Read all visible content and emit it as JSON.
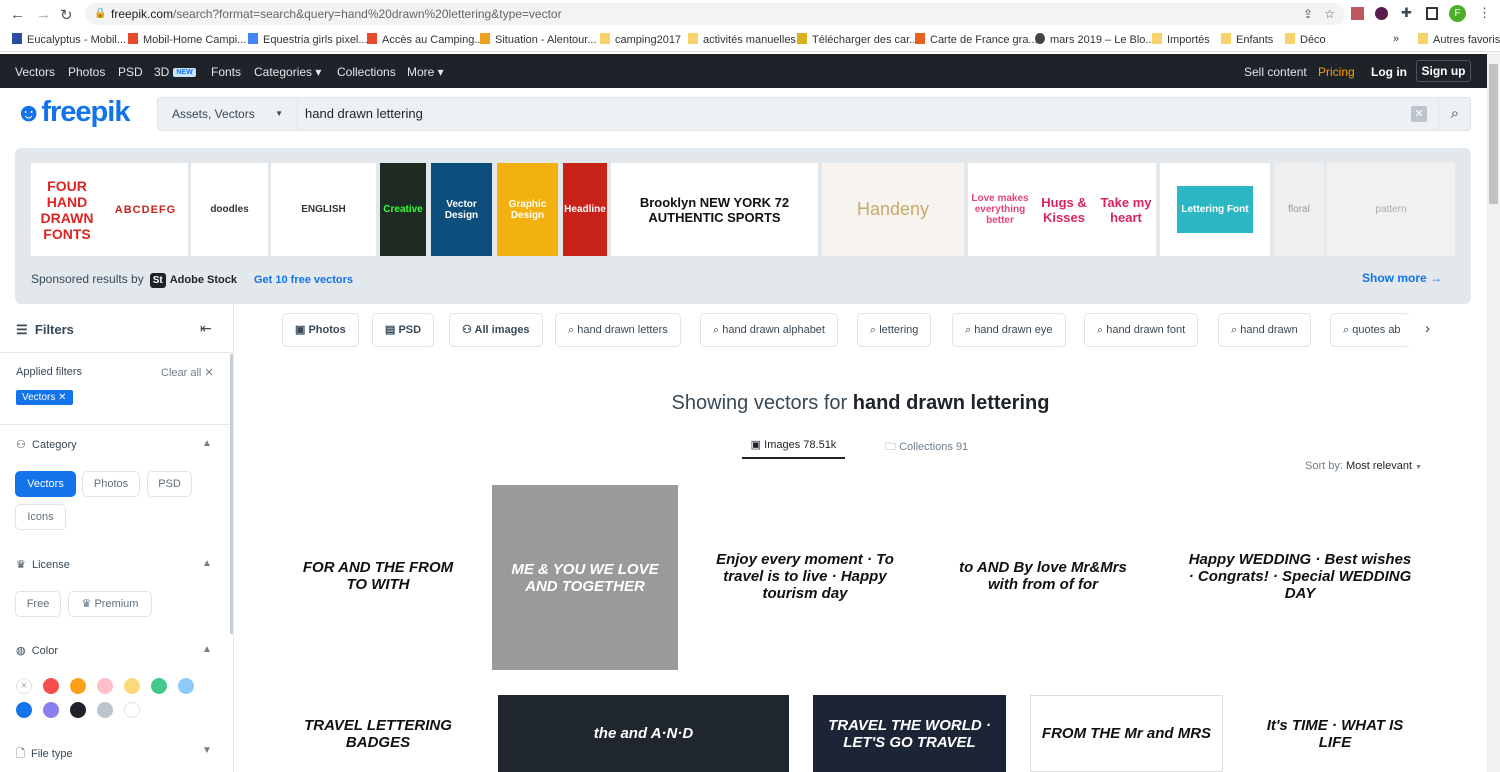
{
  "browser": {
    "url_domain": "freepik.com",
    "url_path": "/search?format=search&query=hand%20drawn%20lettering&type=vector",
    "profile_initial": "F",
    "bookmarks": [
      "Eucalyptus - Mobil...",
      "Mobil-Home Campi...",
      "Equestria girls pixel...",
      "Accès au Camping...",
      "Situation - Alentour...",
      "camping2017",
      "activités manuelles",
      "Télécharger des car...",
      "Carte de France gra...",
      "mars 2019 – Le Blo...",
      "Importés",
      "Enfants",
      "Déco"
    ],
    "more": "»",
    "other_bookmarks": "Autres favoris"
  },
  "topnav": {
    "items": [
      "Vectors",
      "Photos",
      "PSD",
      "3D",
      "Fonts",
      "Categories ▾",
      "Collections",
      "More ▾"
    ],
    "new_badge": "NEW",
    "sell": "Sell content",
    "pricing": "Pricing",
    "login": "Log in",
    "signup": "Sign up",
    "pricing_color": "#ff9e00"
  },
  "header": {
    "logo": "freepik",
    "search_type": "Assets, Vectors",
    "query": "hand drawn lettering",
    "brand_color": "#1273eb"
  },
  "sponsored": {
    "label": "Sponsored results by",
    "provider": "Adobe Stock",
    "provider_mark": "St",
    "promo": "Get 10 free vectors",
    "show_more": "Show more →",
    "thumbs": [
      "FOUR HAND DRAWN FONTS",
      "ABCDEFG",
      "doodles",
      "ENGLISH",
      "Creative",
      "Vector Design",
      "Graphic Design",
      "Headline",
      "Brooklyn NEW YORK 72 AUTHENTIC SPORTS",
      "Handeny",
      "Love makes everything better",
      "Hugs & Kisses",
      "Take my heart",
      "Lettering Font",
      "floral",
      "pattern"
    ]
  },
  "sidebar": {
    "title": "Filters",
    "applied_label": "Applied filters",
    "clear_all": "Clear all ✕",
    "applied_tag": "Vectors ✕",
    "category": {
      "title": "Category",
      "options": [
        "Vectors",
        "Photos",
        "PSD",
        "Icons"
      ]
    },
    "license": {
      "title": "License",
      "options": [
        "Free",
        "Premium"
      ]
    },
    "color": {
      "title": "Color",
      "swatches": [
        "none",
        "#f84d4d",
        "#ff9f1c",
        "#ffc0cb",
        "#fcd97b",
        "#40c98b",
        "#8ecaf9",
        "#1273eb",
        "#8a7ff0",
        "#1d2329",
        "#bcc5cd",
        "#ffffff"
      ]
    },
    "filetype": {
      "title": "File type"
    }
  },
  "chips": [
    "Photos",
    "PSD",
    "All images",
    "hand drawn letters",
    "hand drawn alphabet",
    "lettering",
    "hand drawn eye",
    "hand drawn font",
    "hand drawn",
    "quotes ab"
  ],
  "results": {
    "heading_prefix": "Showing vectors for",
    "heading_query": "hand drawn lettering",
    "tabs": [
      {
        "label": "Images",
        "count": "78.51k"
      },
      {
        "label": "Collections",
        "count": "91"
      }
    ],
    "sort_label": "Sort by:",
    "sort_value": "Most relevant",
    "row1": [
      "FOR AND THE FROM TO WITH",
      "ME & YOU WE LOVE AND TOGETHER",
      "Enjoy every moment · To travel is to live · Happy tourism day",
      "to AND By love Mr&Mrs with from of for",
      "Happy WEDDING · Best wishes · Congrats! · Special WEDDING DAY"
    ],
    "row2": [
      "TRAVEL LETTERING BADGES",
      "the and A·N·D",
      "TRAVEL THE WORLD · LET'S GO TRAVEL",
      "FROM THE Mr and MRS",
      "It's TIME · WHAT IS LIFE"
    ]
  }
}
